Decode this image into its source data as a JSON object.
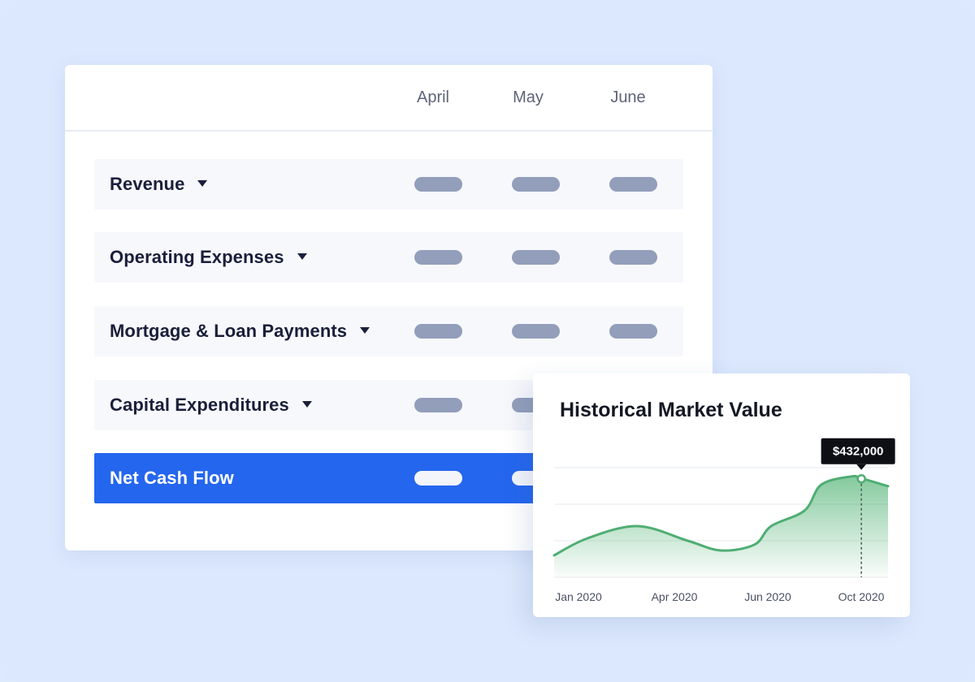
{
  "table": {
    "months": [
      "April",
      "May",
      "June"
    ],
    "rows": [
      {
        "label": "Revenue",
        "has_dropdown": true
      },
      {
        "label": "Operating Expenses",
        "has_dropdown": true
      },
      {
        "label": "Mortgage & Loan Payments",
        "has_dropdown": true
      },
      {
        "label": "Capital Expenditures",
        "has_dropdown": true
      },
      {
        "label": "Net Cash Flow",
        "has_dropdown": false
      }
    ],
    "icons": {
      "row_toggle": "caret-down-icon"
    }
  },
  "chart": {
    "title": "Historical Market Value",
    "tooltip_value": "$432,000"
  },
  "chart_data": {
    "type": "area",
    "title": "Historical Market Value",
    "x_ticks": [
      "Jan 2020",
      "Apr 2020",
      "Jun 2020",
      "Oct 2020"
    ],
    "x": [
      0,
      0.1,
      0.25,
      0.4,
      0.5,
      0.6,
      0.65,
      0.75,
      0.8,
      0.89,
      0.92,
      1.0
    ],
    "y": [
      300000,
      335000,
      360000,
      330000,
      310000,
      322000,
      360000,
      392000,
      445000,
      462000,
      458000,
      442000
    ],
    "ylim": [
      255000,
      480000
    ],
    "gridlines": 3,
    "highlight": {
      "label": "Oct 2020",
      "value": "$432,000"
    },
    "colors": {
      "line": "#4fae73",
      "fill": "#7cc694"
    }
  },
  "colors": {
    "background": "#dce8fd",
    "accent": "#2466ee",
    "placeholder": "#929eba"
  }
}
